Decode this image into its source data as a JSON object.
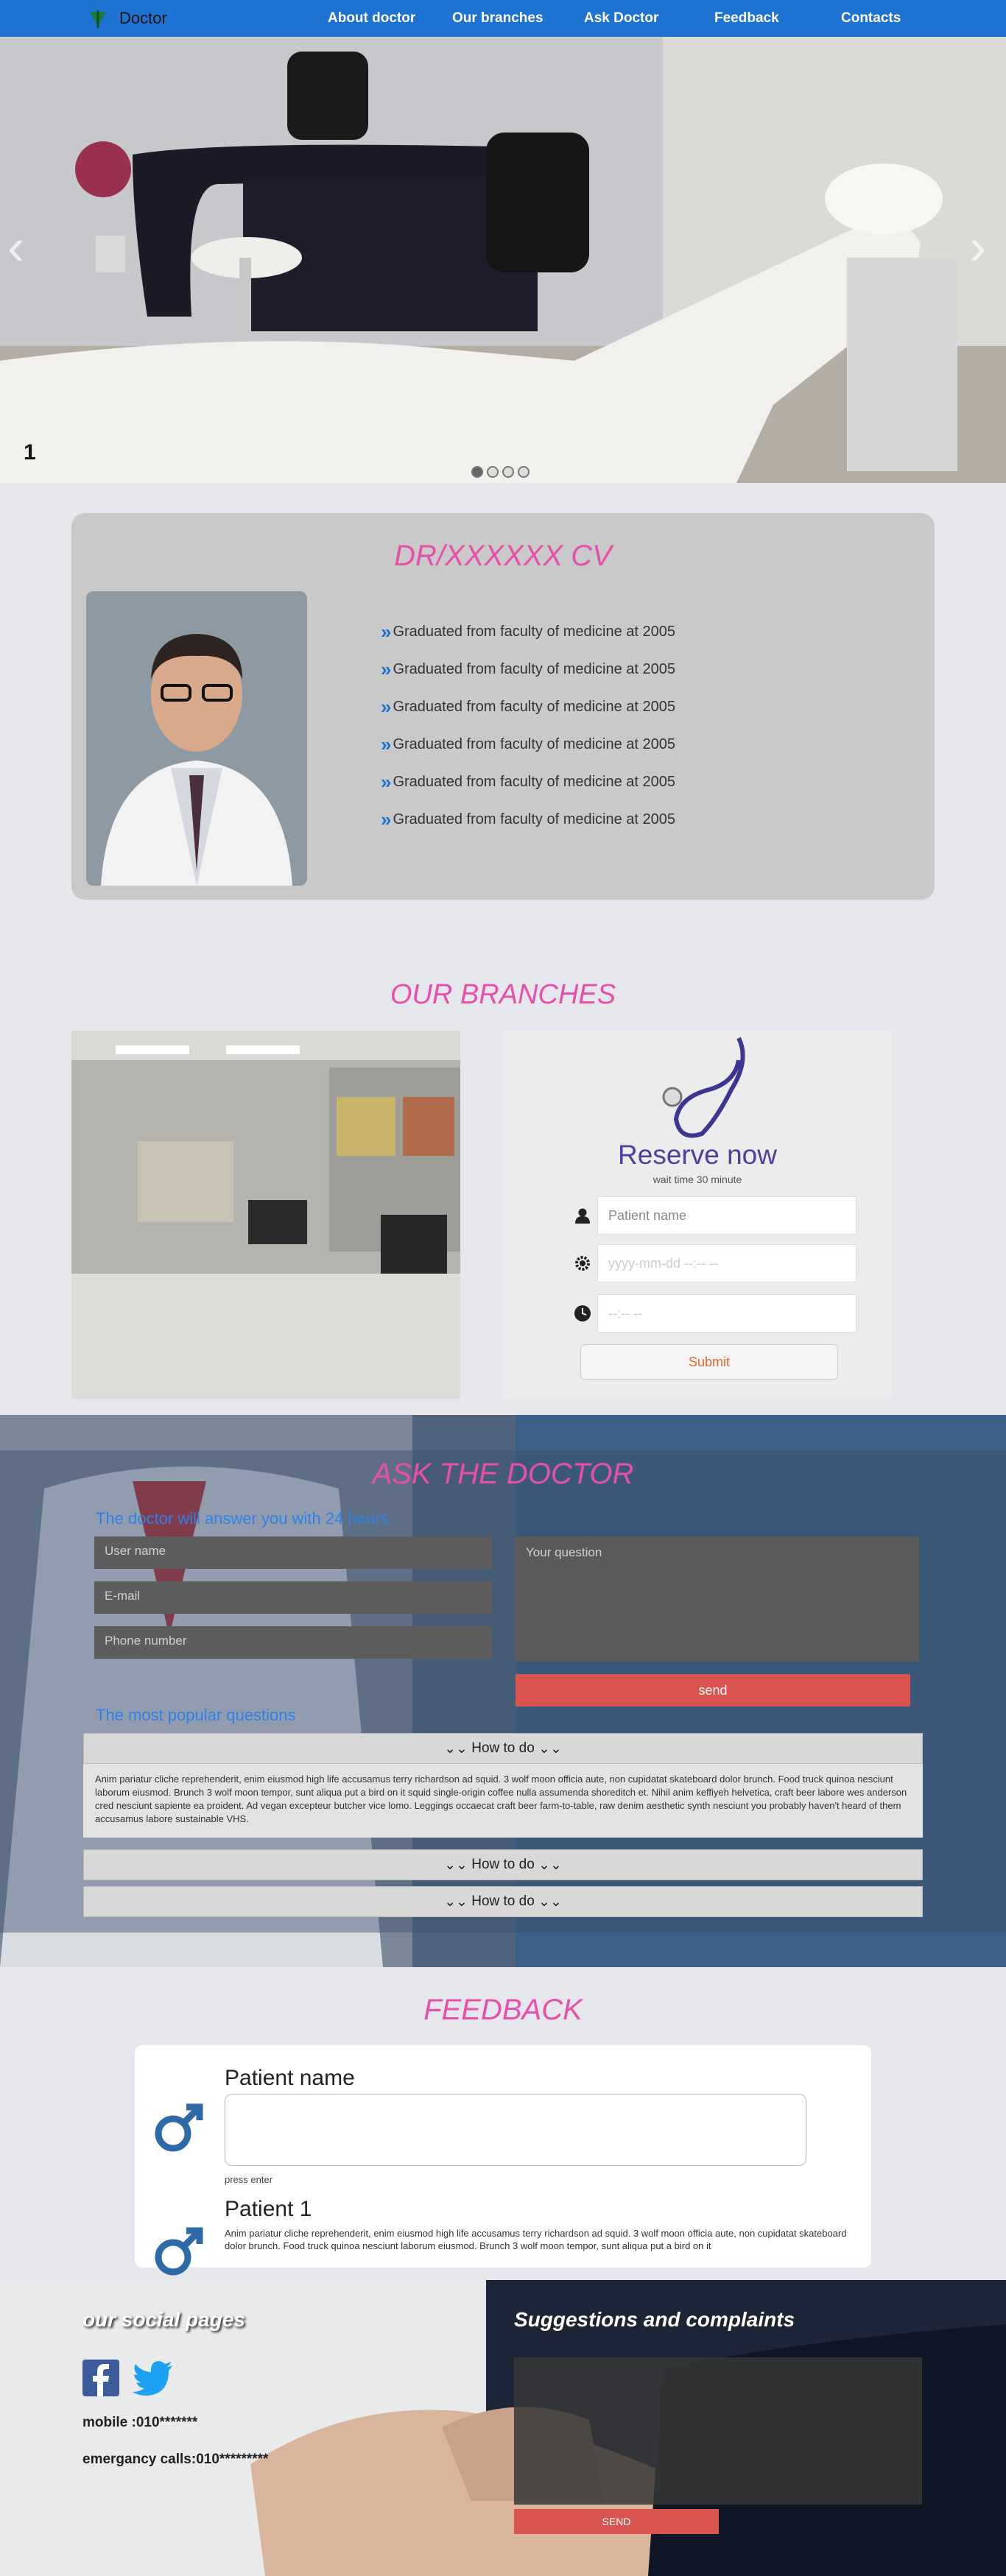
{
  "nav": {
    "brand": "Doctor",
    "links": [
      "About doctor",
      "Our branches",
      "Ask Doctor",
      "Feedback",
      "Contacts"
    ]
  },
  "hero": {
    "slide_number": "1",
    "dot_count": 4,
    "active_dot": 1
  },
  "cv": {
    "title": "DR/XXXXXX CV",
    "items": [
      "Graduated from faculty of medicine at 2005",
      "Graduated from faculty of medicine at 2005",
      "Graduated from faculty of medicine at 2005",
      "Graduated from faculty of medicine at 2005",
      "Graduated from faculty of medicine at 2005",
      "Graduated from faculty of medicine at 2005"
    ]
  },
  "branches": {
    "title": "OUR BRANCHES",
    "reserve_title": "Reserve now",
    "wait_text": "wait time 30 minute",
    "patient_placeholder": "Patient name",
    "date_placeholder": "yyyy-mm-dd --:-- --",
    "time_placeholder": "--:-- --",
    "submit_label": "Submit"
  },
  "ask": {
    "title": "ASK THE DOCTOR",
    "note": "The doctor will answer you with 24 hours",
    "user_placeholder": "User name",
    "email_placeholder": "E-mail",
    "phone_placeholder": "Phone number",
    "question_placeholder": "Your question",
    "send_label": "send",
    "popular_title": "The most popular questions",
    "accordion": [
      {
        "label": "How to do",
        "expanded": true
      },
      {
        "label": "How to do",
        "expanded": false
      },
      {
        "label": "How to do",
        "expanded": false
      }
    ],
    "answer": "Anim pariatur cliche reprehenderit, enim eiusmod high life accusamus terry richardson ad squid. 3 wolf moon officia aute, non cupidatat skateboard dolor brunch. Food truck quinoa nesciunt laborum eiusmod. Brunch 3 wolf moon tempor, sunt aliqua put a bird on it squid single-origin coffee nulla assumenda shoreditch et. Nihil anim keffiyeh helvetica, craft beer labore wes anderson cred nesciunt sapiente ea proident. Ad vegan excepteur butcher vice lomo. Leggings occaecat craft beer farm-to-table, raw denim aesthetic synth nesciunt you probably haven't heard of them accusamus labore sustainable VHS."
  },
  "feedback": {
    "title": "FEEDBACK",
    "form_name": "Patient name",
    "hint": "press enter",
    "comment_name": "Patient 1",
    "comment_text": "Anim pariatur cliche reprehenderit, enim eiusmod high life accusamus terry richardson ad squid. 3 wolf moon officia aute, non cupidatat skateboard dolor brunch. Food truck quinoa nesciunt laborum eiusmod. Brunch 3 wolf moon tempor, sunt aliqua put a bird on it"
  },
  "footer": {
    "social_title": "our social pages",
    "mobile": "mobile :010*******",
    "emergency": "emergancy calls:010*********",
    "suggest_title": "Suggestions and complaints",
    "send_label": "SEND",
    "icons": [
      "facebook-icon",
      "twitter-icon"
    ]
  },
  "colors": {
    "nav": "#1e73d2",
    "heading_pink": "#e84fa8",
    "send_red": "#d9534f",
    "link_blue": "#2f80e8",
    "reserve_purple": "#4b3fa0"
  }
}
